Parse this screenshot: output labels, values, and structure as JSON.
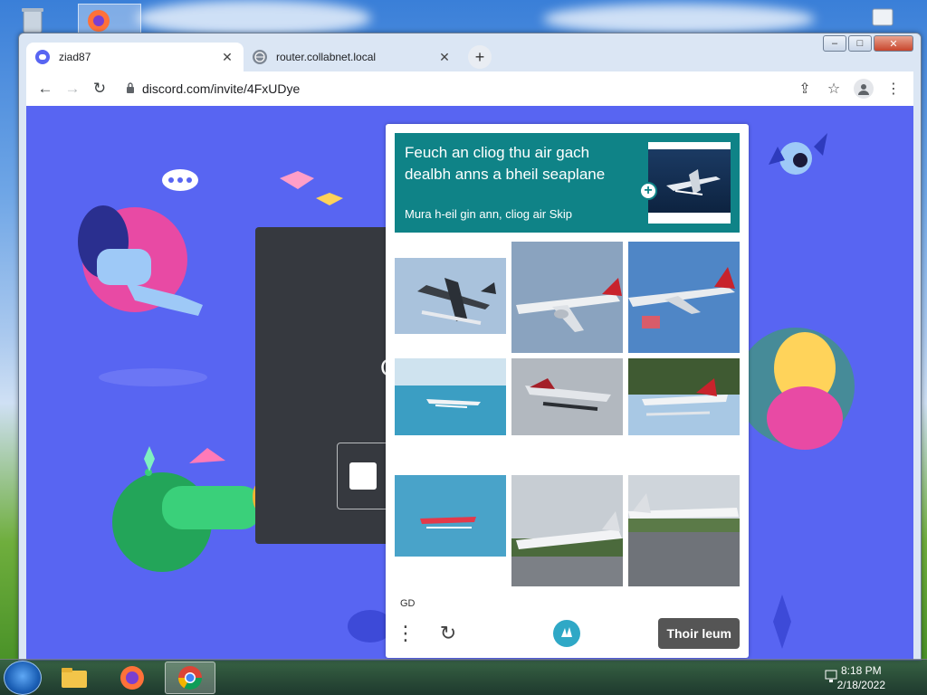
{
  "browser": {
    "tabs": [
      {
        "label": "ziad87",
        "active": true,
        "icon": "discord-icon"
      },
      {
        "label": "router.collabnet.local",
        "active": false,
        "icon": "globe-icon"
      }
    ],
    "new_tab": "+",
    "address": "discord.com/invite/4FxUDye",
    "window_controls": {
      "minimize": "–",
      "maximize": "□",
      "close": "✕"
    }
  },
  "page": {
    "partial_heading": "C"
  },
  "captcha": {
    "prompt": "Feuch an cliog thu air gach dealbh anns a bheil seaplane",
    "hint": "Mura h-eil gin ann, cliog air Skip",
    "images": [
      {
        "subject": "seaplane flying",
        "scene": "sky"
      },
      {
        "subject": "airliner",
        "scene": "sky"
      },
      {
        "subject": "airliner",
        "scene": "sky"
      },
      {
        "subject": "seaplane on water",
        "scene": "water"
      },
      {
        "subject": "seaplane flying",
        "scene": "cloud"
      },
      {
        "subject": "seaplane",
        "scene": "forest"
      },
      {
        "subject": "seaplane on water",
        "scene": "water"
      },
      {
        "subject": "jet on runway",
        "scene": "runway"
      },
      {
        "subject": "airliner on runway",
        "scene": "runway"
      }
    ],
    "language": "GD",
    "menu": "⋮",
    "refresh": "↻",
    "skip_label": "Thoir leum"
  },
  "taskbar": {
    "time": "8:18 PM",
    "date": "2/18/2022"
  },
  "colors": {
    "discord_bg": "#5865f2",
    "captcha_header": "#0f8387",
    "skip_button": "#555555"
  }
}
